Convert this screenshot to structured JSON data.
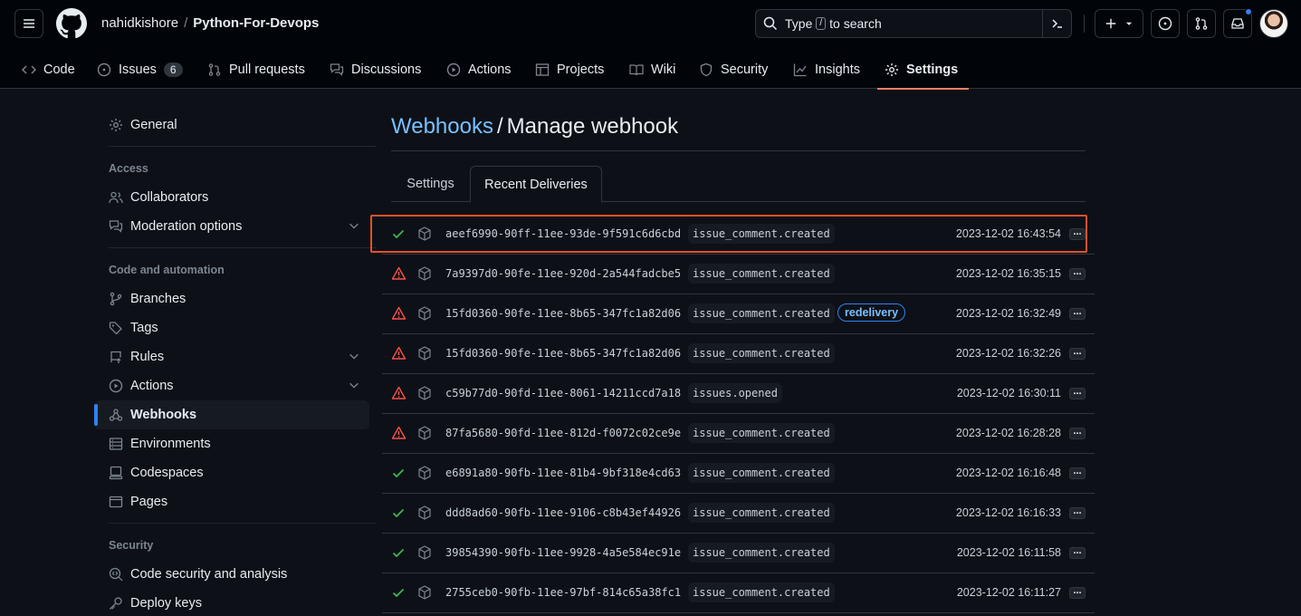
{
  "header": {
    "owner": "nahidkishore",
    "separator": "/",
    "repo": "Python-For-Devops",
    "search_prefix": "Type",
    "search_key": "/",
    "search_suffix": "to search"
  },
  "repo_nav": {
    "items": [
      {
        "label": "Code",
        "icon": "code-icon"
      },
      {
        "label": "Issues",
        "icon": "issue-opened-icon",
        "count": "6"
      },
      {
        "label": "Pull requests",
        "icon": "git-pull-request-icon"
      },
      {
        "label": "Discussions",
        "icon": "comment-discussion-icon"
      },
      {
        "label": "Actions",
        "icon": "play-icon"
      },
      {
        "label": "Projects",
        "icon": "table-icon"
      },
      {
        "label": "Wiki",
        "icon": "book-icon"
      },
      {
        "label": "Security",
        "icon": "shield-icon"
      },
      {
        "label": "Insights",
        "icon": "graph-icon"
      },
      {
        "label": "Settings",
        "icon": "gear-icon",
        "active": true
      }
    ]
  },
  "sidebar": {
    "general": "General",
    "access_heading": "Access",
    "collaborators": "Collaborators",
    "moderation": "Moderation options",
    "code_heading": "Code and automation",
    "branches": "Branches",
    "tags": "Tags",
    "rules": "Rules",
    "actions": "Actions",
    "webhooks": "Webhooks",
    "environments": "Environments",
    "codespaces": "Codespaces",
    "pages": "Pages",
    "security_heading": "Security",
    "code_security": "Code security and analysis",
    "deploy_keys": "Deploy keys"
  },
  "main": {
    "breadcrumb": "Webhooks",
    "slash": "/",
    "title": "Manage webhook",
    "tabs": [
      "Settings",
      "Recent Deliveries"
    ],
    "active_tab": "Recent Deliveries"
  },
  "deliveries": [
    {
      "status": "success",
      "guid": "aeef6990-90ff-11ee-93de-9f591c6d6cbd",
      "event": "issue_comment.created",
      "badge": "",
      "time": "2023-12-02 16:43:54"
    },
    {
      "status": "failure",
      "guid": "7a9397d0-90fe-11ee-920d-2a544fadcbe5",
      "event": "issue_comment.created",
      "badge": "",
      "time": "2023-12-02 16:35:15"
    },
    {
      "status": "failure",
      "guid": "15fd0360-90fe-11ee-8b65-347fc1a82d06",
      "event": "issue_comment.created",
      "badge": "redelivery",
      "time": "2023-12-02 16:32:49"
    },
    {
      "status": "failure",
      "guid": "15fd0360-90fe-11ee-8b65-347fc1a82d06",
      "event": "issue_comment.created",
      "badge": "",
      "time": "2023-12-02 16:32:26"
    },
    {
      "status": "failure",
      "guid": "c59b77d0-90fd-11ee-8061-14211ccd7a18",
      "event": "issues.opened",
      "badge": "",
      "time": "2023-12-02 16:30:11"
    },
    {
      "status": "failure",
      "guid": "87fa5680-90fd-11ee-812d-f0072c02ce9e",
      "event": "issue_comment.created",
      "badge": "",
      "time": "2023-12-02 16:28:28"
    },
    {
      "status": "success",
      "guid": "e6891a80-90fb-11ee-81b4-9bf318e4cd63",
      "event": "issue_comment.created",
      "badge": "",
      "time": "2023-12-02 16:16:48"
    },
    {
      "status": "success",
      "guid": "ddd8ad60-90fb-11ee-9106-c8b43ef44926",
      "event": "issue_comment.created",
      "badge": "",
      "time": "2023-12-02 16:16:33"
    },
    {
      "status": "success",
      "guid": "39854390-90fb-11ee-9928-4a5e584ec91e",
      "event": "issue_comment.created",
      "badge": "",
      "time": "2023-12-02 16:11:58"
    },
    {
      "status": "success",
      "guid": "2755ceb0-90fb-11ee-97bf-814c65a38fc1",
      "event": "issue_comment.created",
      "badge": "",
      "time": "2023-12-02 16:11:27"
    }
  ],
  "colors": {
    "success": "#3fb950",
    "failure": "#f85149",
    "accent": "#2f81f7",
    "highlight": "#e5502c"
  }
}
